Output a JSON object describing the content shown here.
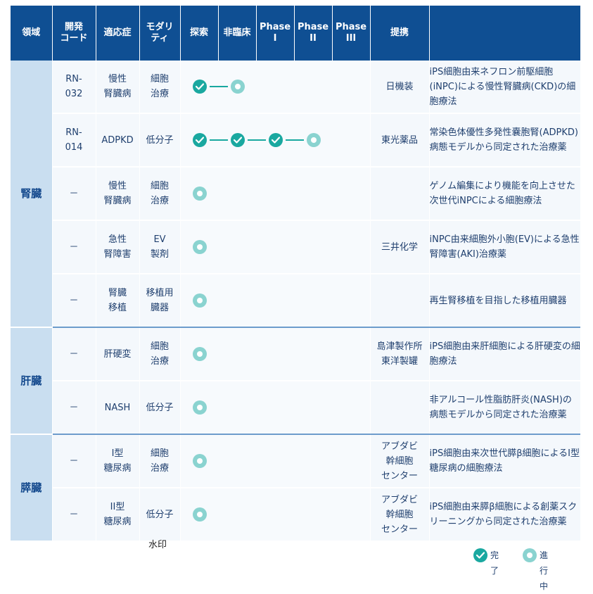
{
  "header": {
    "area": "領域",
    "code_l1": "開発",
    "code_l2": "コード",
    "indication": "適応症",
    "modality_l1": "モダリ",
    "modality_l2": "ティ",
    "discovery": "探索",
    "preclinical": "非臨床",
    "phase1_l1": "Phase",
    "phase1_l2": "I",
    "phase2_l1": "Phase",
    "phase2_l2": "II",
    "phase3_l1": "Phase",
    "phase3_l2": "III",
    "partner": "提携"
  },
  "areas": {
    "kidney": "腎臓",
    "liver": "肝臓",
    "pancreas": "膵臓"
  },
  "rows": [
    {
      "code": [
        "RN-",
        "032"
      ],
      "indication": [
        "慢性",
        "腎臓病"
      ],
      "modality": [
        "細胞",
        "治療"
      ],
      "stages": 2,
      "partner": [
        "日機装"
      ],
      "desc": "iPS細胞由来ネフロン前駆細胞(iNPC)による慢性腎臓病(CKD)の細胞療法"
    },
    {
      "code": [
        "RN-",
        "014"
      ],
      "indication": [
        "ADPKD"
      ],
      "modality": [
        "低分子"
      ],
      "stages": 4,
      "partner": [
        "東光薬品"
      ],
      "desc": "常染色体優性多発性嚢胞腎(ADPKD)病態モデルから同定された治療薬"
    },
    {
      "code": [
        "－"
      ],
      "indication": [
        "慢性",
        "腎臓病"
      ],
      "modality": [
        "細胞",
        "治療"
      ],
      "stages": 1,
      "partner": [],
      "desc": "ゲノム編集により機能を向上させた次世代iNPCによる細胞療法"
    },
    {
      "code": [
        "－"
      ],
      "indication": [
        "急性",
        "腎障害"
      ],
      "modality": [
        "EV",
        "製剤"
      ],
      "stages": 1,
      "partner": [
        "三井化学"
      ],
      "desc": "iNPC由来細胞外小胞(EV)による急性腎障害(AKI)治療薬"
    },
    {
      "code": [
        "－"
      ],
      "indication": [
        "腎臓",
        "移植"
      ],
      "modality": [
        "移植用",
        "臓器"
      ],
      "stages": 1,
      "partner": [],
      "desc": "再生腎移植を目指した移植用臓器"
    },
    {
      "code": [
        "－"
      ],
      "indication": [
        "肝硬変"
      ],
      "modality": [
        "細胞",
        "治療"
      ],
      "stages": 1,
      "partner": [
        "島津製作所",
        "東洋製罐"
      ],
      "desc": "iPS細胞由来肝細胞による肝硬変の細胞療法"
    },
    {
      "code": [
        "－"
      ],
      "indication": [
        "NASH"
      ],
      "modality": [
        "低分子"
      ],
      "stages": 1,
      "partner": [],
      "desc": "非アルコール性脂肪肝炎(NASH)の病態モデルから同定された治療薬"
    },
    {
      "code": [
        "－"
      ],
      "indication": [
        "I型",
        "糖尿病"
      ],
      "modality": [
        "細胞",
        "治療"
      ],
      "stages": 1,
      "partner": [
        "アブダビ",
        "幹細胞",
        "センター"
      ],
      "desc": "iPS細胞由来次世代膵β細胞によるI型糖尿病の細胞療法"
    },
    {
      "code": [
        "－"
      ],
      "indication": [
        "II型",
        "糖尿病"
      ],
      "modality": [
        "低分子"
      ],
      "stages": 1,
      "partner": [
        "アブダビ",
        "幹細胞",
        "センター"
      ],
      "desc": "iPS細胞由来膵β細胞による創薬スクリーニングから同定された治療薬"
    }
  ],
  "watermark": "水印",
  "legend": {
    "done_label": "完了",
    "progress_label": "進行中"
  },
  "colors": {
    "header_bg": "#0f4f93",
    "area_bg": "#c9def0",
    "row_bg": "#f4f8fc",
    "done": "#1aa8a0",
    "in_progress": "#8ad3d0"
  }
}
